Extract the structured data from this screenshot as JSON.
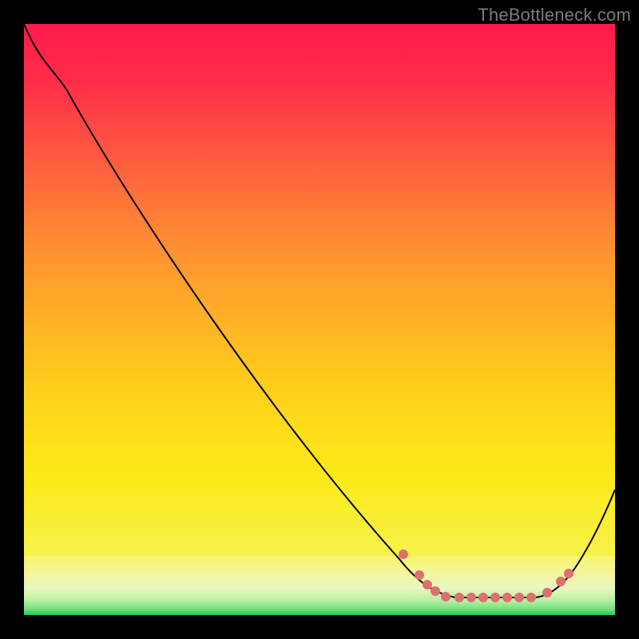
{
  "watermark": "TheBottleneck.com",
  "colors": {
    "curve": "#000000",
    "dot": "#df6f6e",
    "gradient_top": "#ff1a4c",
    "gradient_mid": "#ffd21a",
    "gradient_bottom": "#1fc95a",
    "page_bg": "#000000"
  },
  "chart_data": {
    "type": "line",
    "title": "",
    "xlabel": "",
    "ylabel": "",
    "xlim": [
      0,
      100
    ],
    "ylim": [
      0,
      100
    ],
    "grid": false,
    "note": "No axis ticks or numeric labels are visible; values are chart-relative percentages (0 at left/bottom, 100 at right/top). The background is a vertical gradient from red (high y) through yellow to green (low y).",
    "series": [
      {
        "name": "curve",
        "color": "#000000",
        "x": [
          0,
          7,
          18,
          30,
          41,
          51,
          58,
          63,
          70,
          76,
          82,
          86,
          90,
          95,
          100
        ],
        "y": [
          100,
          89,
          72,
          52,
          35,
          20,
          12,
          9,
          4,
          3,
          3,
          3,
          5,
          10,
          21
        ]
      }
    ],
    "highlighted_points": {
      "name": "optimal-range",
      "color": "#df6f6e",
      "x": [
        64,
        67,
        68,
        70,
        71,
        74,
        76,
        78,
        80,
        82,
        84,
        86,
        89,
        91,
        92
      ],
      "y": [
        10,
        7,
        5,
        4,
        3,
        3,
        3,
        3,
        3,
        3,
        3,
        3,
        4,
        6,
        7
      ]
    }
  }
}
